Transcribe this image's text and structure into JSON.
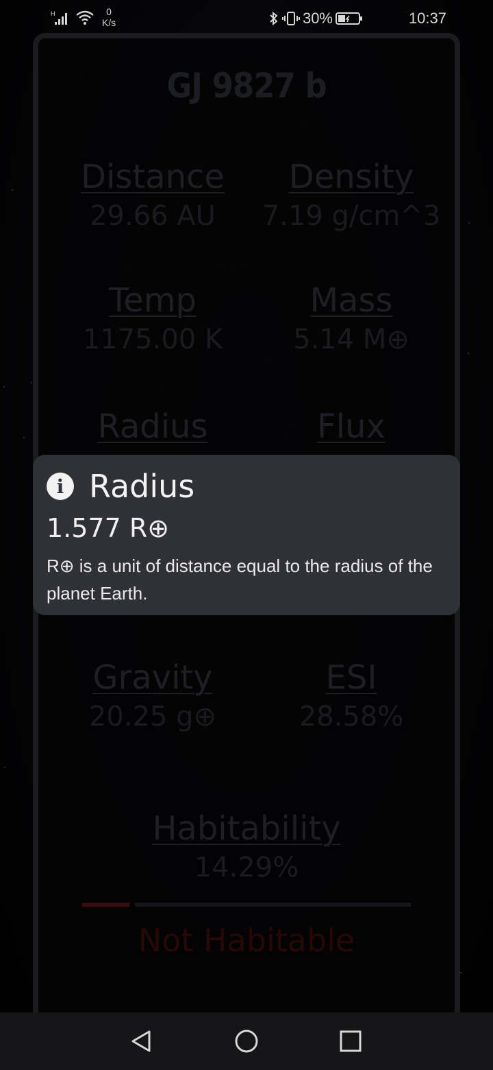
{
  "status_bar": {
    "network_type": "H",
    "net_speed_value": "0",
    "net_speed_unit": "K/s",
    "battery": "30%",
    "time": "10:37"
  },
  "planet": {
    "name": "GJ 9827 b"
  },
  "stats": {
    "distance": {
      "label": "Distance",
      "value": "29.66 AU"
    },
    "density": {
      "label": "Density",
      "value": "7.19 g/cm^3"
    },
    "temp": {
      "label": "Temp",
      "value": "1175.00 K"
    },
    "mass": {
      "label": "Mass",
      "value": "5.14 M⊕"
    },
    "radius": {
      "label": "Radius"
    },
    "flux": {
      "label": "Flux"
    },
    "gravity": {
      "label": "Gravity",
      "value": "20.25 g⊕"
    },
    "esi": {
      "label": "ESI",
      "value": "28.58%"
    }
  },
  "habitability": {
    "label": "Habitability",
    "value": "14.29%",
    "progress": 0.1429,
    "status": "Not Habitable"
  },
  "toast": {
    "icon": "info-icon",
    "title": "Radius",
    "value": "1.577 R⊕",
    "description": "R⊕ is a unit of distance equal to the radius of the planet Earth."
  },
  "nav_bar": {
    "icons": [
      "back-icon",
      "home-icon",
      "recents-icon"
    ]
  },
  "colors": {
    "toast_bg": "#303136",
    "card_border": "#1b1b1f",
    "hab_status": "#280707",
    "nav_bg": "#151517"
  }
}
